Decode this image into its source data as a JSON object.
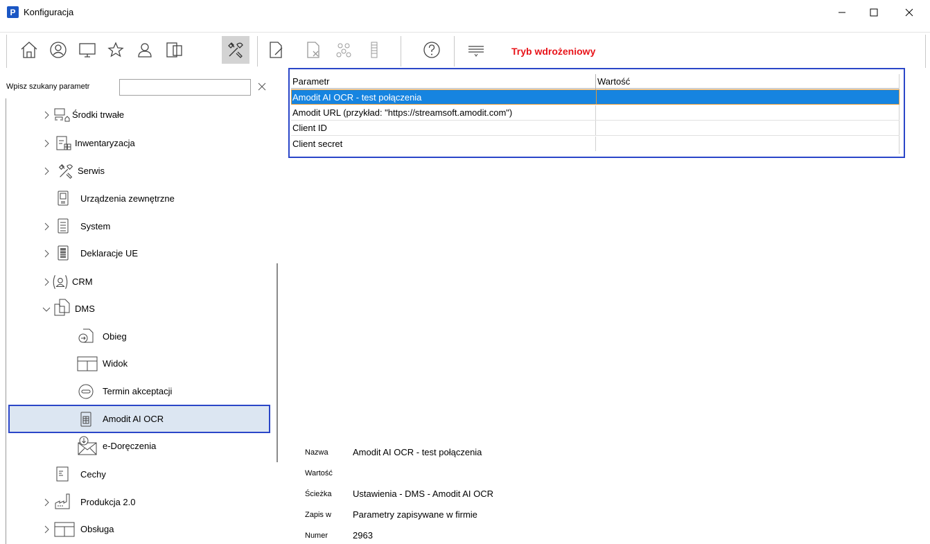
{
  "window": {
    "title": "Konfiguracja",
    "logo_letter": "P"
  },
  "toolbar": {
    "icons": [
      "home-icon",
      "user-circle-icon",
      "monitor-icon",
      "star-icon",
      "person-icon",
      "devices-icon",
      "tools-icon",
      "document-edit-icon",
      "document-delete-icon",
      "group-icon",
      "column-icon",
      "help-icon",
      "filter-lines-icon"
    ],
    "mode_label": "Tryb wdrożeniowy",
    "mode_color": "#e8141a"
  },
  "search": {
    "label": "Wpisz szukany parametr",
    "value": "",
    "clear": "×"
  },
  "tree": {
    "items": [
      {
        "label": "Środki trwałe",
        "icon": "fixed-assets-icon",
        "expander": "collapsed"
      },
      {
        "label": "Inwentaryzacja",
        "icon": "inventory-icon",
        "expander": "collapsed"
      },
      {
        "label": "Serwis",
        "icon": "tools-icon",
        "expander": "collapsed"
      },
      {
        "label": "Urządzenia zewnętrzne",
        "icon": "device-icon",
        "expander": "none"
      },
      {
        "label": "System",
        "icon": "system-icon",
        "expander": "collapsed"
      },
      {
        "label": "Deklaracje UE",
        "icon": "declaration-icon",
        "expander": "collapsed"
      },
      {
        "label": "CRM",
        "icon": "crm-icon",
        "expander": "collapsed"
      },
      {
        "label": "DMS",
        "icon": "dms-icon",
        "expander": "expanded"
      },
      {
        "label": "Obieg",
        "icon": "flow-icon",
        "expander": "none"
      },
      {
        "label": "Widok",
        "icon": "view-icon",
        "expander": "none"
      },
      {
        "label": "Termin akceptacji",
        "icon": "deadline-icon",
        "expander": "none"
      },
      {
        "label": "Amodit AI OCR",
        "icon": "ocr-icon",
        "expander": "none",
        "selected": true
      },
      {
        "label": "e-Doręczenia",
        "icon": "edelivery-icon",
        "expander": "none"
      },
      {
        "label": "Cechy",
        "icon": "features-icon",
        "expander": "none"
      },
      {
        "label": "Produkcja 2.0",
        "icon": "production-icon",
        "expander": "collapsed"
      },
      {
        "label": "Obsługa",
        "icon": "service-icon",
        "expander": "collapsed"
      }
    ]
  },
  "grid": {
    "headers": [
      "Parametr",
      "Wartość"
    ],
    "rows": [
      {
        "param": "Amodit AI OCR - test połączenia",
        "value": "",
        "selected": true
      },
      {
        "param": "Amodit URL (przykład: \"https://streamsoft.amodit.com\")",
        "value": ""
      },
      {
        "param": "Client ID",
        "value": ""
      },
      {
        "param": "Client secret",
        "value": ""
      }
    ]
  },
  "details": {
    "name_label": "Nazwa",
    "name_value": "Amodit AI OCR - test połączenia",
    "value_label": "Wartość",
    "value_value": "",
    "path_label": "Ścieżka",
    "path_value": "Ustawienia - DMS - Amodit AI OCR",
    "save_label": "Zapis w",
    "save_value": "Parametry zapisywane w firmie",
    "number_label": "Numer",
    "number_value": "2963"
  },
  "colors": {
    "selection_blue": "#1684e0",
    "highlight_border": "#2a46c8",
    "tree_selected_bg": "#dce6f2"
  }
}
